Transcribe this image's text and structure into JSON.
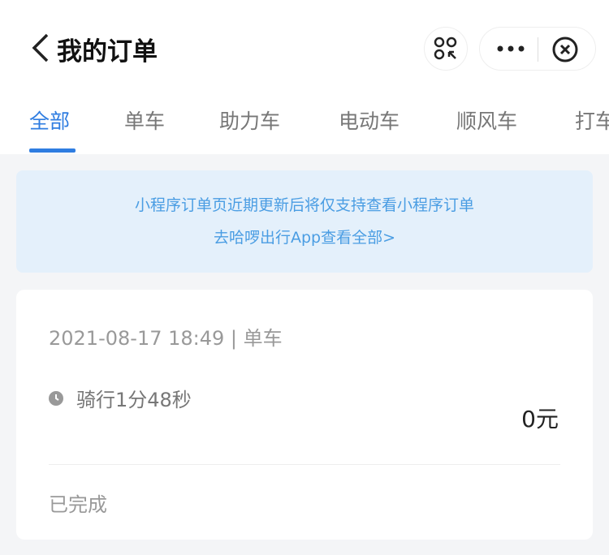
{
  "header": {
    "title": "我的订单"
  },
  "tabs": [
    {
      "label": "全部",
      "active": true
    },
    {
      "label": "单车"
    },
    {
      "label": "助力车"
    },
    {
      "label": "电动车"
    },
    {
      "label": "顺风车"
    },
    {
      "label": "打车"
    }
  ],
  "banner": {
    "line1": "小程序订单页近期更新后将仅支持查看小程序订单",
    "line2": "去哈啰出行App查看全部>"
  },
  "order": {
    "datetime": "2021-08-17 18:49 | 单车",
    "duration": "骑行1分48秒",
    "price": "0元",
    "status": "已完成"
  },
  "colors": {
    "accent": "#2f7de1",
    "banner_bg": "#e4f0fb",
    "banner_text": "#4a9de3"
  }
}
